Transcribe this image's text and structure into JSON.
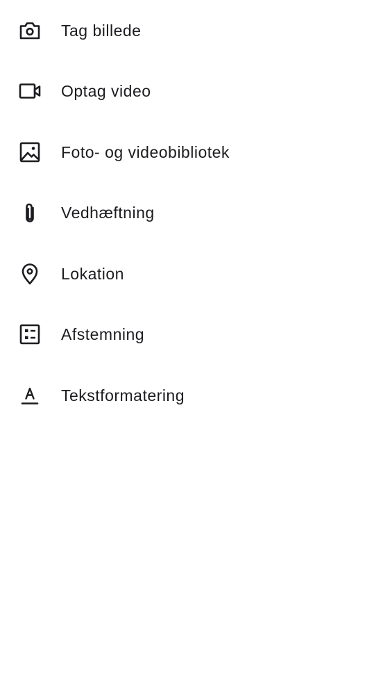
{
  "menu": {
    "items": [
      {
        "label": "Tag billede",
        "icon": "camera-icon"
      },
      {
        "label": "Optag video",
        "icon": "videocam-icon"
      },
      {
        "label": "Foto- og videobibliotek",
        "icon": "image-icon"
      },
      {
        "label": "Vedhæftning",
        "icon": "paperclip-icon"
      },
      {
        "label": "Lokation",
        "icon": "location-pin-icon"
      },
      {
        "label": "Afstemning",
        "icon": "poll-icon"
      },
      {
        "label": "Tekstformatering",
        "icon": "text-format-icon"
      }
    ]
  },
  "colors": {
    "background": "#ffffff",
    "text": "#1c1b1f",
    "icon": "#1c1b1f"
  }
}
